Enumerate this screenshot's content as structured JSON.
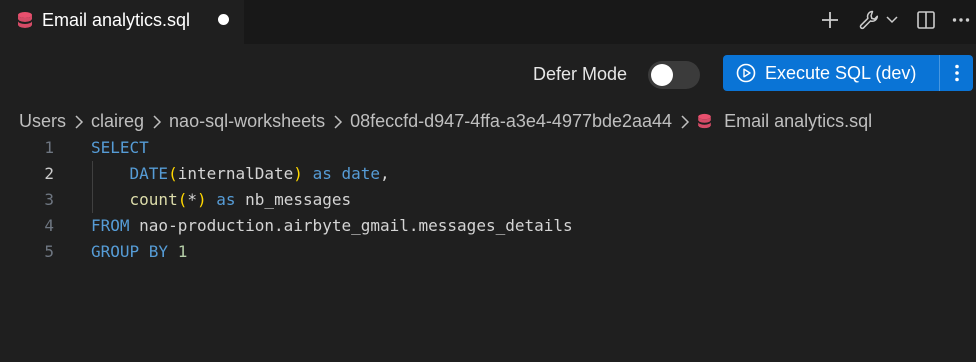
{
  "tab": {
    "title": "Email analytics.sql",
    "dirty": true
  },
  "tab_actions": {
    "icons": [
      "plus-icon",
      "wrench-icon",
      "chevron-down-icon",
      "split-editor-icon",
      "more-icon"
    ]
  },
  "toolbar": {
    "defer_mode_label": "Defer Mode",
    "defer_mode_on": false,
    "execute_label": "Execute SQL (dev)"
  },
  "breadcrumb": {
    "items": [
      "Users",
      "claireg",
      "nao-sql-worksheets",
      "08feccfd-d947-4ffa-a3e4-4977bde2aa44",
      "Email analytics.sql"
    ]
  },
  "editor": {
    "active_line": 2,
    "line_numbers": [
      "1",
      "2",
      "3",
      "4",
      "5"
    ],
    "lines": [
      {
        "tokens": [
          {
            "t": "kw",
            "v": "SELECT"
          }
        ]
      },
      {
        "tokens": [
          {
            "t": "id",
            "v": "    "
          },
          {
            "t": "kw",
            "v": "DATE"
          },
          {
            "t": "br",
            "v": "("
          },
          {
            "t": "id",
            "v": "internalDate"
          },
          {
            "t": "br",
            "v": ")"
          },
          {
            "t": "id",
            "v": " "
          },
          {
            "t": "kw",
            "v": "as"
          },
          {
            "t": "id",
            "v": " "
          },
          {
            "t": "kw",
            "v": "date"
          },
          {
            "t": "id",
            "v": ","
          }
        ]
      },
      {
        "tokens": [
          {
            "t": "id",
            "v": "    "
          },
          {
            "t": "fn",
            "v": "count"
          },
          {
            "t": "br",
            "v": "("
          },
          {
            "t": "id",
            "v": "*"
          },
          {
            "t": "br",
            "v": ")"
          },
          {
            "t": "id",
            "v": " "
          },
          {
            "t": "kw",
            "v": "as"
          },
          {
            "t": "id",
            "v": " nb_messages"
          }
        ]
      },
      {
        "tokens": [
          {
            "t": "kw",
            "v": "FROM"
          },
          {
            "t": "id",
            "v": " nao-production.airbyte_gmail.messages_details"
          }
        ]
      },
      {
        "tokens": [
          {
            "t": "kw",
            "v": "GROUP BY"
          },
          {
            "t": "id",
            "v": " "
          },
          {
            "t": "num",
            "v": "1"
          }
        ]
      }
    ]
  },
  "colors": {
    "editor_bg": "#1f1f1f",
    "tabbar_bg": "#181818",
    "execute_button": "#0a74d6",
    "keyword": "#569cd6",
    "function": "#dcdcaa",
    "bracket": "#ffd700",
    "number": "#b5cea8",
    "db_icon": "#e8506e"
  }
}
